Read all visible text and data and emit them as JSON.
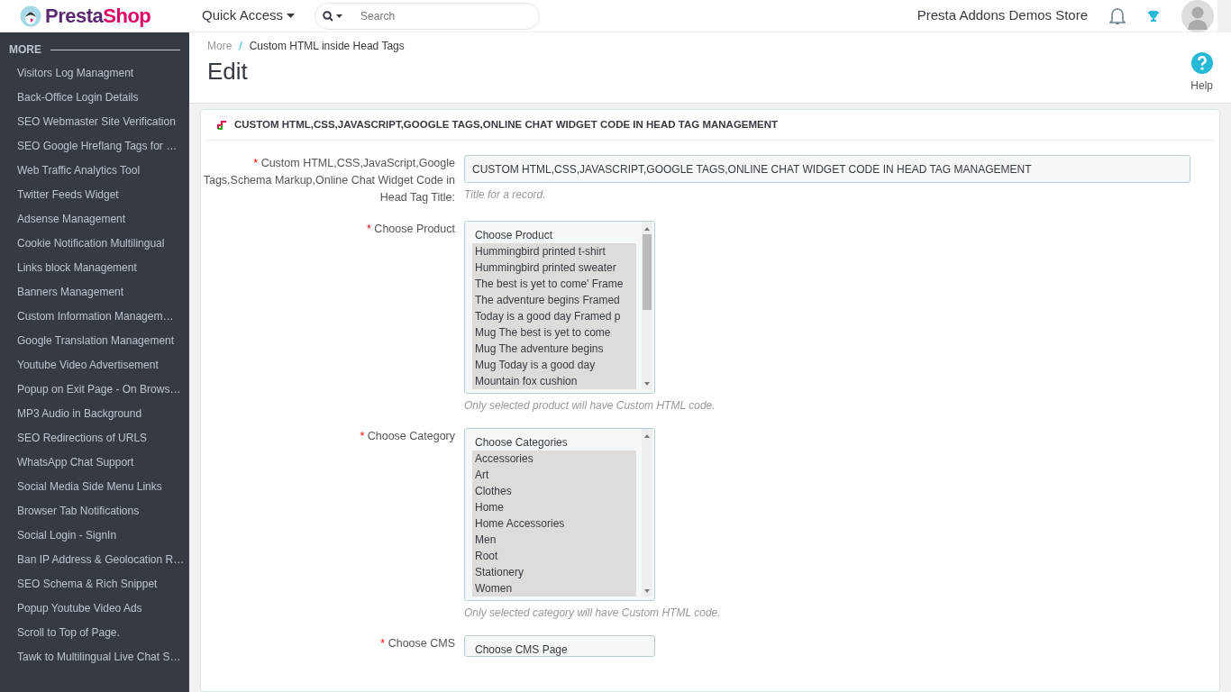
{
  "header": {
    "logo": "PrestaShop",
    "quick_access": "Quick Access",
    "search": {
      "placeholder": "Search"
    },
    "store_name": "Presta Addons Demos Store"
  },
  "sidebar": {
    "heading": "MORE",
    "items": [
      {
        "label": "Visitors Log Managment"
      },
      {
        "label": "Back-Office Login Details"
      },
      {
        "label": "SEO Webmaster Site Verification"
      },
      {
        "label": "SEO Google Hreflang Tags for …"
      },
      {
        "label": "Web Traffic Analytics Tool"
      },
      {
        "label": "Twitter Feeds Widget"
      },
      {
        "label": "Adsense Management"
      },
      {
        "label": "Cookie Notification Multilingual"
      },
      {
        "label": "Links block Management"
      },
      {
        "label": "Banners Management"
      },
      {
        "label": "Custom Information Managem…"
      },
      {
        "label": "Google Translation Management"
      },
      {
        "label": "Youtube Video Advertisement"
      },
      {
        "label": "Popup on Exit Page - On Brows…"
      },
      {
        "label": "MP3 Audio in Background"
      },
      {
        "label": "SEO Redirections of URLS"
      },
      {
        "label": "WhatsApp Chat Support"
      },
      {
        "label": "Social Media Side Menu Links"
      },
      {
        "label": "Browser Tab Notifications"
      },
      {
        "label": "Social Login - SignIn"
      },
      {
        "label": "Ban IP Address & Geolocation R…"
      },
      {
        "label": "SEO Schema & Rich Snippet"
      },
      {
        "label": "Popup Youtube Video Ads"
      },
      {
        "label": "Scroll to Top of Page."
      },
      {
        "label": "Tawk to Multilingual Live Chat S…"
      }
    ]
  },
  "breadcrumb": {
    "separator": "/",
    "items": [
      "More",
      "Custom HTML inside Head Tags"
    ]
  },
  "page_title": "Edit",
  "help": "Help",
  "panel": {
    "title": "CUSTOM HTML,CSS,JAVASCRIPT,GOOGLE TAGS,ONLINE CHAT WIDGET CODE IN HEAD TAG MANAGEMENT",
    "fields": [
      {
        "kind": "text",
        "required": "*",
        "label": "Custom HTML,CSS,JavaScript,Google Tags,Schema Markup,Online Chat Widget Code in Head Tag Title:",
        "value": "CUSTOM HTML,CSS,JAVASCRIPT,GOOGLE TAGS,ONLINE CHAT WIDGET CODE IN HEAD TAG MANAGEMENT",
        "help": "Title for a record."
      },
      {
        "kind": "list",
        "required": "*",
        "label": "Choose Product",
        "options": [
          {
            "label": "Choose Product",
            "selected": false
          },
          {
            "label": "Hummingbird printed t-shirt",
            "selected": true
          },
          {
            "label": "Hummingbird printed sweater",
            "selected": true
          },
          {
            "label": "The best is yet to come' Frame",
            "selected": true
          },
          {
            "label": "The adventure begins Framed",
            "selected": true
          },
          {
            "label": "Today is a good day Framed p",
            "selected": true
          },
          {
            "label": "Mug The best is yet to come",
            "selected": true
          },
          {
            "label": "Mug The adventure begins",
            "selected": true
          },
          {
            "label": "Mug Today is a good day",
            "selected": true
          },
          {
            "label": "Mountain fox cushion",
            "selected": true
          }
        ],
        "help": "Only selected product will have Custom HTML code."
      },
      {
        "kind": "list",
        "required": "*",
        "label": "Choose Category",
        "options": [
          {
            "label": "Choose Categories",
            "selected": false
          },
          {
            "label": "Accessories",
            "selected": true
          },
          {
            "label": "Art",
            "selected": true
          },
          {
            "label": "Clothes",
            "selected": true
          },
          {
            "label": "Home",
            "selected": true
          },
          {
            "label": "Home Accessories",
            "selected": true
          },
          {
            "label": "Men",
            "selected": true
          },
          {
            "label": "Root",
            "selected": true
          },
          {
            "label": "Stationery",
            "selected": true
          },
          {
            "label": "Women",
            "selected": true
          }
        ],
        "help": "Only selected category will have Custom HTML code."
      },
      {
        "kind": "list",
        "required": "*",
        "label": "Choose CMS",
        "options": [
          {
            "label": "Choose CMS Page",
            "selected": false
          }
        ]
      }
    ]
  }
}
